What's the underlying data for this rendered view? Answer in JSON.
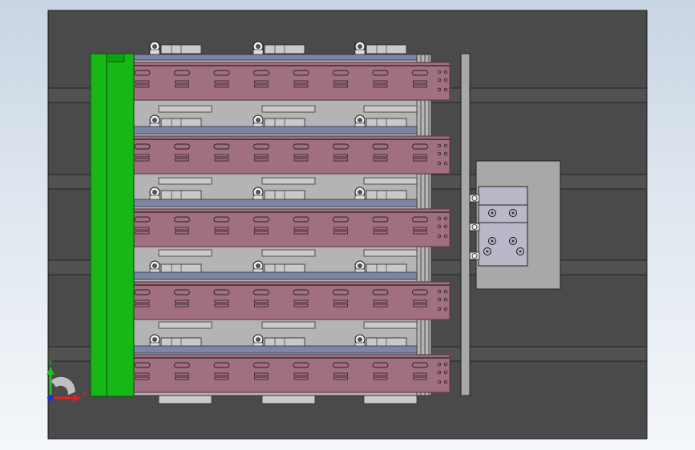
{
  "viewport": {
    "background_top": "#c9d5e3",
    "background_bottom": "#f4f7fa"
  },
  "palette": {
    "base_plate": "#4a4a4a",
    "rail": "#515151",
    "green_bar": "#16b816",
    "frame": "#b4b4b4",
    "pink_plate": "#a07081",
    "pink_edge": "#5e3f4a",
    "blue_bar": "#7c86a3",
    "steel": "#c9c9c9",
    "cylinder_plate": "#a8a8a8",
    "block": "#b8b8c8"
  },
  "assembly": {
    "pink_plate_rows": 5,
    "slots_per_plate": 8,
    "roller_columns": 3,
    "side_cylinder_count": 1,
    "cylinder_ports": 3
  },
  "triad": {
    "y_label": "Y",
    "x_label": "X",
    "y_color": "#20c020",
    "x_color": "#e02020",
    "z_color": "#2030d0"
  }
}
